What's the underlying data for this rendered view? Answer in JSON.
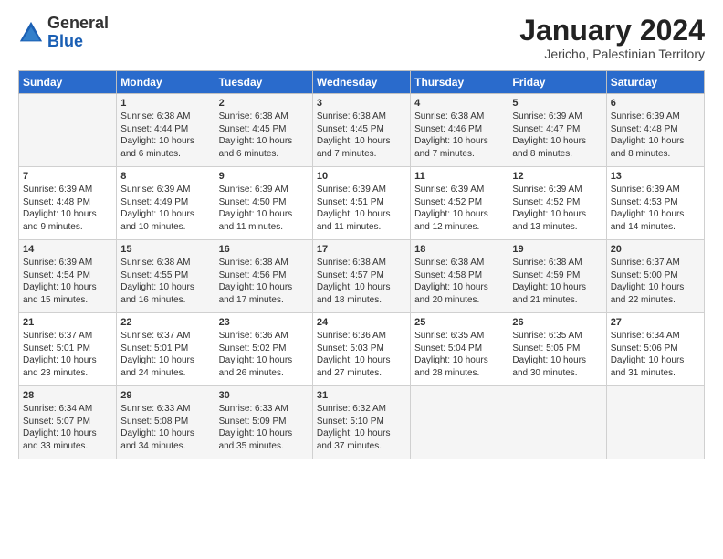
{
  "header": {
    "logo_general": "General",
    "logo_blue": "Blue",
    "month_title": "January 2024",
    "location": "Jericho, Palestinian Territory"
  },
  "columns": [
    "Sunday",
    "Monday",
    "Tuesday",
    "Wednesday",
    "Thursday",
    "Friday",
    "Saturday"
  ],
  "weeks": [
    [
      {
        "day": "",
        "content": ""
      },
      {
        "day": "1",
        "content": "Sunrise: 6:38 AM\nSunset: 4:44 PM\nDaylight: 10 hours\nand 6 minutes."
      },
      {
        "day": "2",
        "content": "Sunrise: 6:38 AM\nSunset: 4:45 PM\nDaylight: 10 hours\nand 6 minutes."
      },
      {
        "day": "3",
        "content": "Sunrise: 6:38 AM\nSunset: 4:45 PM\nDaylight: 10 hours\nand 7 minutes."
      },
      {
        "day": "4",
        "content": "Sunrise: 6:38 AM\nSunset: 4:46 PM\nDaylight: 10 hours\nand 7 minutes."
      },
      {
        "day": "5",
        "content": "Sunrise: 6:39 AM\nSunset: 4:47 PM\nDaylight: 10 hours\nand 8 minutes."
      },
      {
        "day": "6",
        "content": "Sunrise: 6:39 AM\nSunset: 4:48 PM\nDaylight: 10 hours\nand 8 minutes."
      }
    ],
    [
      {
        "day": "7",
        "content": "Sunrise: 6:39 AM\nSunset: 4:48 PM\nDaylight: 10 hours\nand 9 minutes."
      },
      {
        "day": "8",
        "content": "Sunrise: 6:39 AM\nSunset: 4:49 PM\nDaylight: 10 hours\nand 10 minutes."
      },
      {
        "day": "9",
        "content": "Sunrise: 6:39 AM\nSunset: 4:50 PM\nDaylight: 10 hours\nand 11 minutes."
      },
      {
        "day": "10",
        "content": "Sunrise: 6:39 AM\nSunset: 4:51 PM\nDaylight: 10 hours\nand 11 minutes."
      },
      {
        "day": "11",
        "content": "Sunrise: 6:39 AM\nSunset: 4:52 PM\nDaylight: 10 hours\nand 12 minutes."
      },
      {
        "day": "12",
        "content": "Sunrise: 6:39 AM\nSunset: 4:52 PM\nDaylight: 10 hours\nand 13 minutes."
      },
      {
        "day": "13",
        "content": "Sunrise: 6:39 AM\nSunset: 4:53 PM\nDaylight: 10 hours\nand 14 minutes."
      }
    ],
    [
      {
        "day": "14",
        "content": "Sunrise: 6:39 AM\nSunset: 4:54 PM\nDaylight: 10 hours\nand 15 minutes."
      },
      {
        "day": "15",
        "content": "Sunrise: 6:38 AM\nSunset: 4:55 PM\nDaylight: 10 hours\nand 16 minutes."
      },
      {
        "day": "16",
        "content": "Sunrise: 6:38 AM\nSunset: 4:56 PM\nDaylight: 10 hours\nand 17 minutes."
      },
      {
        "day": "17",
        "content": "Sunrise: 6:38 AM\nSunset: 4:57 PM\nDaylight: 10 hours\nand 18 minutes."
      },
      {
        "day": "18",
        "content": "Sunrise: 6:38 AM\nSunset: 4:58 PM\nDaylight: 10 hours\nand 20 minutes."
      },
      {
        "day": "19",
        "content": "Sunrise: 6:38 AM\nSunset: 4:59 PM\nDaylight: 10 hours\nand 21 minutes."
      },
      {
        "day": "20",
        "content": "Sunrise: 6:37 AM\nSunset: 5:00 PM\nDaylight: 10 hours\nand 22 minutes."
      }
    ],
    [
      {
        "day": "21",
        "content": "Sunrise: 6:37 AM\nSunset: 5:01 PM\nDaylight: 10 hours\nand 23 minutes."
      },
      {
        "day": "22",
        "content": "Sunrise: 6:37 AM\nSunset: 5:01 PM\nDaylight: 10 hours\nand 24 minutes."
      },
      {
        "day": "23",
        "content": "Sunrise: 6:36 AM\nSunset: 5:02 PM\nDaylight: 10 hours\nand 26 minutes."
      },
      {
        "day": "24",
        "content": "Sunrise: 6:36 AM\nSunset: 5:03 PM\nDaylight: 10 hours\nand 27 minutes."
      },
      {
        "day": "25",
        "content": "Sunrise: 6:35 AM\nSunset: 5:04 PM\nDaylight: 10 hours\nand 28 minutes."
      },
      {
        "day": "26",
        "content": "Sunrise: 6:35 AM\nSunset: 5:05 PM\nDaylight: 10 hours\nand 30 minutes."
      },
      {
        "day": "27",
        "content": "Sunrise: 6:34 AM\nSunset: 5:06 PM\nDaylight: 10 hours\nand 31 minutes."
      }
    ],
    [
      {
        "day": "28",
        "content": "Sunrise: 6:34 AM\nSunset: 5:07 PM\nDaylight: 10 hours\nand 33 minutes."
      },
      {
        "day": "29",
        "content": "Sunrise: 6:33 AM\nSunset: 5:08 PM\nDaylight: 10 hours\nand 34 minutes."
      },
      {
        "day": "30",
        "content": "Sunrise: 6:33 AM\nSunset: 5:09 PM\nDaylight: 10 hours\nand 35 minutes."
      },
      {
        "day": "31",
        "content": "Sunrise: 6:32 AM\nSunset: 5:10 PM\nDaylight: 10 hours\nand 37 minutes."
      },
      {
        "day": "",
        "content": ""
      },
      {
        "day": "",
        "content": ""
      },
      {
        "day": "",
        "content": ""
      }
    ]
  ]
}
